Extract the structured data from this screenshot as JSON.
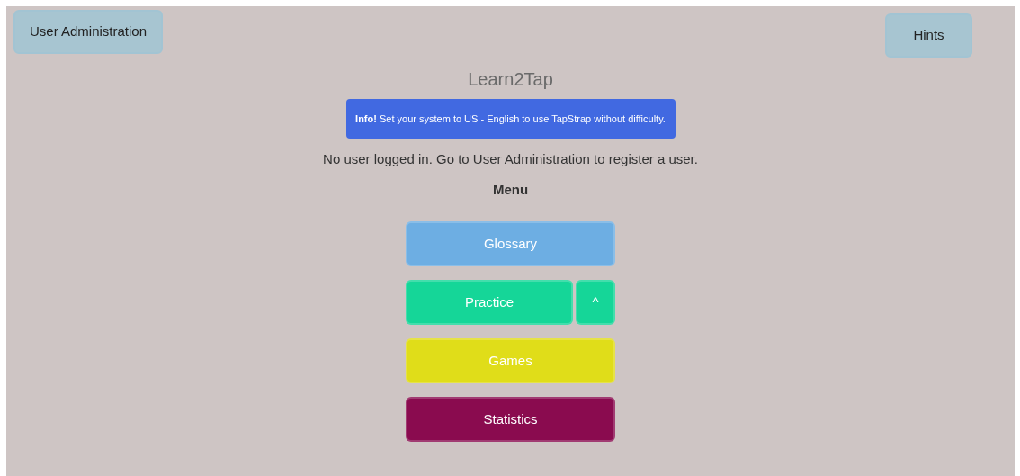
{
  "header": {
    "admin_button": "User Administration",
    "hints_button": "Hints"
  },
  "title": "Learn2Tap",
  "alert": {
    "text": "**Info!** Set your system to US - English to use TapStrap without difficulty."
  },
  "status": "No user logged in. Go to User Administration to register a user.",
  "menu": {
    "heading": "Menu",
    "items": [
      {
        "label": "Glossary",
        "kind": "plain",
        "color": "#6daee3"
      },
      {
        "label": "Practice",
        "kind": "with-toggle",
        "toggle": "^",
        "color": "#15d698"
      },
      {
        "label": "Games",
        "kind": "plain",
        "color": "#e0dd19"
      },
      {
        "label": "Statistics",
        "kind": "plain",
        "color": "#8a0b4f"
      }
    ]
  }
}
